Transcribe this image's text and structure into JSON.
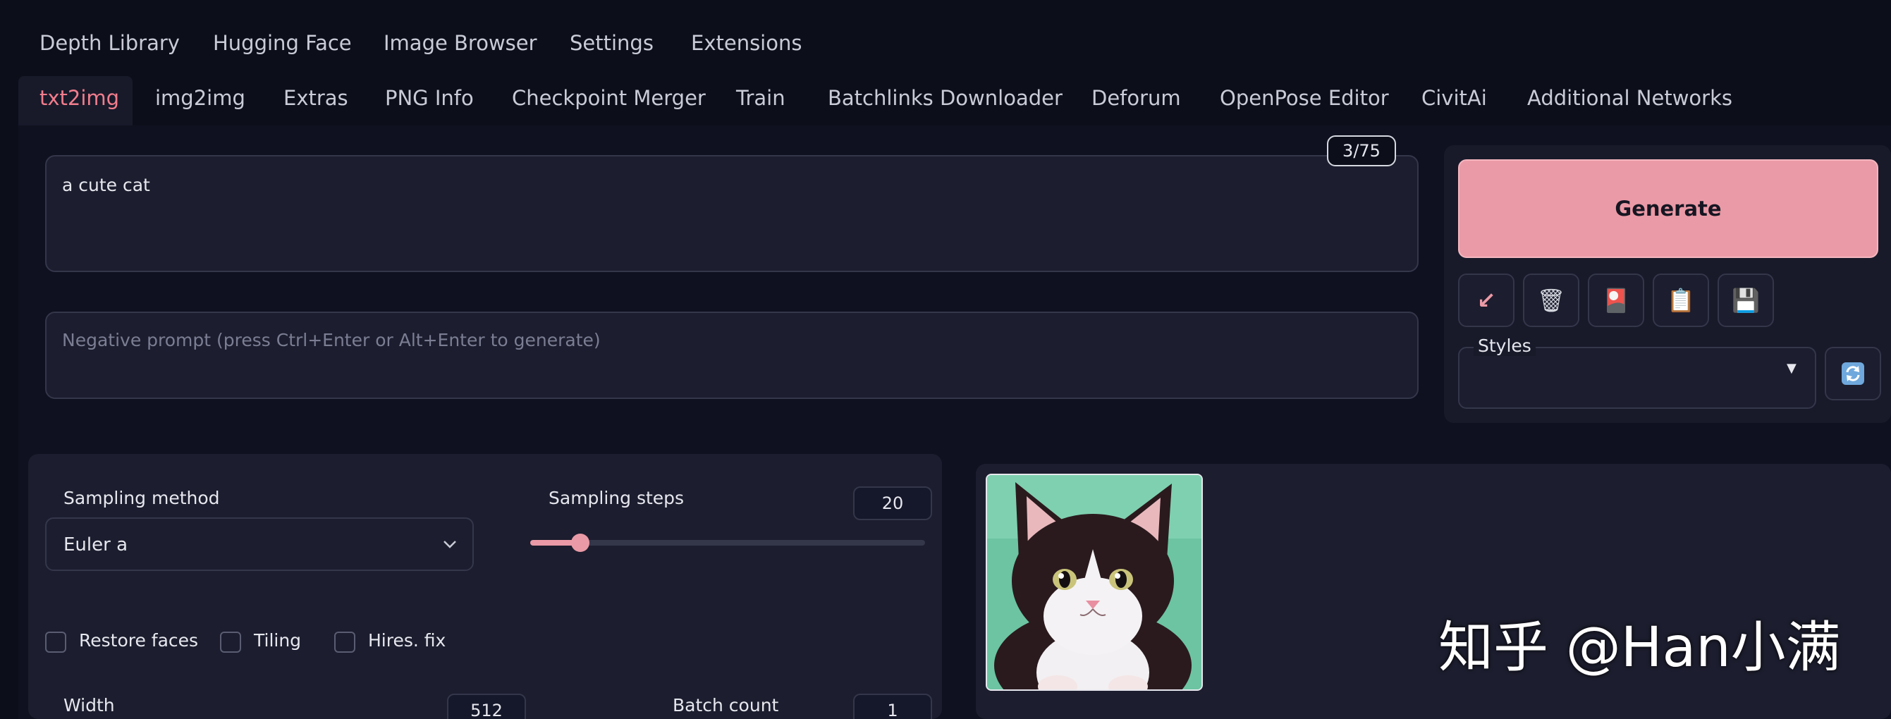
{
  "top_tabs": [
    "Depth Library",
    "Hugging Face",
    "Image Browser",
    "Settings",
    "Extensions"
  ],
  "main_tabs": [
    "txt2img",
    "img2img",
    "Extras",
    "PNG Info",
    "Checkpoint Merger",
    "Train",
    "Batchlinks Downloader",
    "Deforum",
    "OpenPose Editor",
    "CivitAi",
    "Additional Networks"
  ],
  "active_tab": "txt2img",
  "prompt": {
    "value": "a cute cat",
    "token_count": "3/75"
  },
  "negative_prompt": {
    "placeholder": "Negative prompt (press Ctrl+Enter or Alt+Enter to generate)"
  },
  "generate": {
    "label": "Generate"
  },
  "tool_buttons": [
    {
      "icon": "arrow-down-left-icon",
      "glyph": "↙"
    },
    {
      "icon": "trash-icon",
      "glyph": "🗑"
    },
    {
      "icon": "card-icon",
      "glyph": "🎴"
    },
    {
      "icon": "clipboard-icon",
      "glyph": "📋"
    },
    {
      "icon": "save-icon",
      "glyph": "💾"
    }
  ],
  "styles": {
    "label": "Styles",
    "refresh_glyph": "🔄"
  },
  "sampling": {
    "method_label": "Sampling method",
    "method_value": "Euler a",
    "steps_label": "Sampling steps",
    "steps_value": "20",
    "steps_min": 1,
    "steps_max": 150
  },
  "options": {
    "restore_faces": "Restore faces",
    "tiling": "Tiling",
    "hires_fix": "Hires. fix"
  },
  "size": {
    "width_label": "Width",
    "width_value": "512",
    "batch_count_label": "Batch count",
    "batch_count_value": "1"
  },
  "watermark": "知乎 @Han小满",
  "colors": {
    "accent": "#ea9aa6",
    "active_tab": "#f27d8c",
    "background": "#0c0f1a",
    "panel": "#1c1d2e"
  }
}
